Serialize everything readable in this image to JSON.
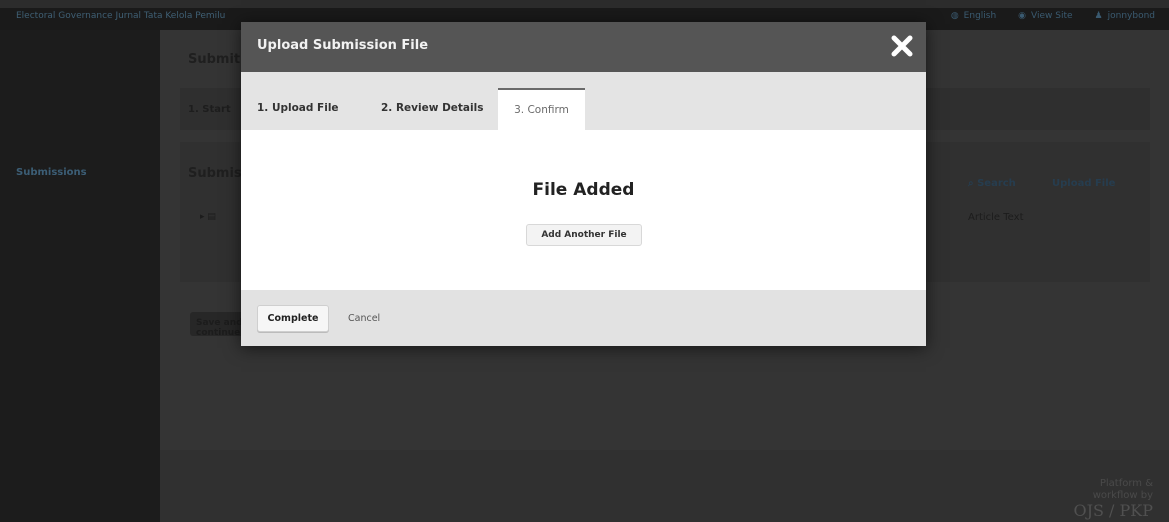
{
  "topbar": {
    "journal_title": "Electoral Governance Jurnal Tata Kelola Pemilu",
    "language": "English",
    "view_site": "View Site",
    "username": "jonnybond"
  },
  "sidebar": {
    "items": [
      {
        "label": "Submissions"
      }
    ]
  },
  "background": {
    "heading_submit": "Submit",
    "tab_start": "1. Start",
    "files_heading": "Submission Files",
    "search_label": "Search",
    "upload_file_label": "Upload File",
    "file_row_type": "Article Text",
    "save_label": "Save and continue",
    "footer_platform": "Platform &",
    "footer_workflow": "workflow by",
    "footer_brand": "OJS / PKP"
  },
  "modal": {
    "title": "Upload Submission File",
    "close_icon": "close-icon",
    "tabs": [
      {
        "label": "1. Upload File"
      },
      {
        "label": "2. Review Details"
      },
      {
        "label": "3. Confirm"
      }
    ],
    "active_tab": "3. Confirm",
    "body": {
      "status": "File Added",
      "add_another_label": "Add Another File"
    },
    "footer": {
      "complete_label": "Complete",
      "cancel_label": "Cancel"
    }
  },
  "colors": {
    "overlay": "#2c2c2c",
    "modal_header": "#555555",
    "link": "#3c5e76"
  }
}
